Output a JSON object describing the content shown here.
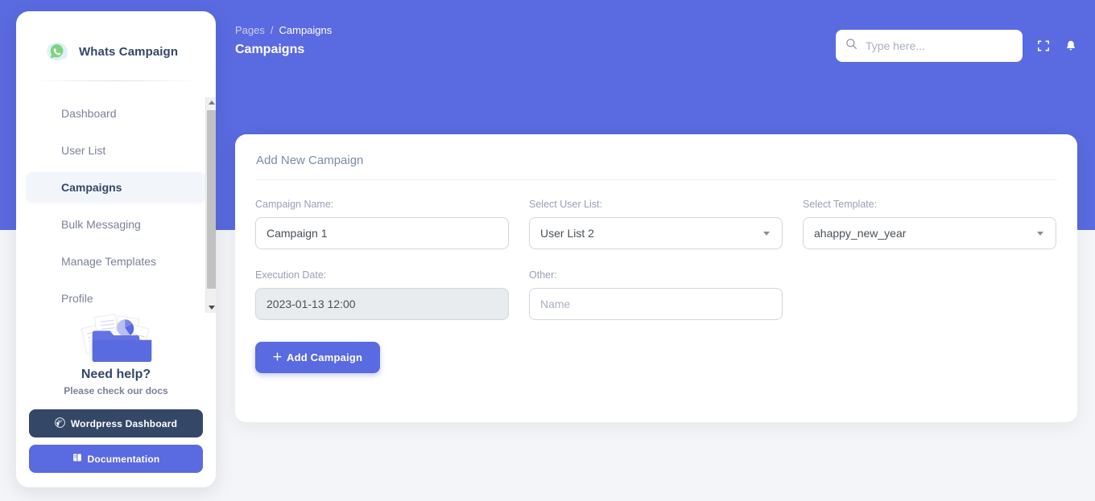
{
  "theme": {
    "accent": "#5a6ae0",
    "dark": "#344767",
    "muted": "#7b809a",
    "page_bg": "#f4f5f8"
  },
  "sidebar": {
    "brand": {
      "title": "Whats Campaign",
      "logo_icon": "whatsapp-icon"
    },
    "items": [
      {
        "label": "Dashboard",
        "active": false
      },
      {
        "label": "User List",
        "active": false
      },
      {
        "label": "Campaigns",
        "active": true
      },
      {
        "label": "Bulk Messaging",
        "active": false
      },
      {
        "label": "Manage Templates",
        "active": false
      },
      {
        "label": "Profile",
        "active": false
      }
    ],
    "help": {
      "illustration_icon": "folder-documents-icon",
      "title": "Need help?",
      "subtitle": "Please check our docs",
      "buttons": [
        {
          "label": "Wordpress Dashboard",
          "icon": "wordpress-icon",
          "style": "dark"
        },
        {
          "label": "Documentation",
          "icon": "book-icon",
          "style": "primary"
        }
      ]
    }
  },
  "topbar": {
    "breadcrumb": {
      "parent": "Pages",
      "separator": "/",
      "current": "Campaigns"
    },
    "page_title": "Campaigns",
    "search": {
      "placeholder": "Type here...",
      "value": "",
      "icon": "search-icon"
    },
    "actions": [
      {
        "name": "fullscreen-button",
        "icon": "expand-icon"
      },
      {
        "name": "notifications-button",
        "icon": "bell-icon"
      }
    ]
  },
  "card": {
    "title": "Add New Campaign",
    "fields": {
      "campaign_name": {
        "label": "Campaign Name:",
        "value": "Campaign 1",
        "placeholder": "",
        "type": "text"
      },
      "user_list": {
        "label": "Select User List:",
        "value": "User List 2",
        "type": "select"
      },
      "template": {
        "label": "Select Template:",
        "value": "ahappy_new_year",
        "type": "select"
      },
      "execution_date": {
        "label": "Execution Date:",
        "value": "2023-01-13 12:00",
        "type": "text",
        "disabled": true
      },
      "other": {
        "label": "Other:",
        "value": "",
        "placeholder": "Name",
        "type": "text"
      }
    },
    "submit": {
      "label": "Add Campaign",
      "icon": "plus-icon"
    }
  }
}
